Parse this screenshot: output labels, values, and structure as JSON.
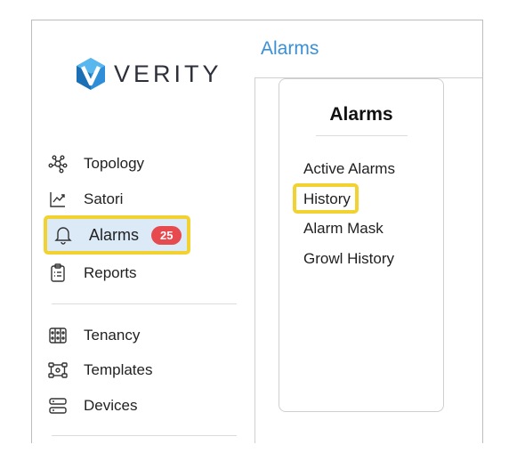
{
  "brand": {
    "name": "VERITY"
  },
  "sidebar": {
    "items": [
      {
        "label": "Topology",
        "icon": "topology-icon"
      },
      {
        "label": "Satori",
        "icon": "chart-icon"
      },
      {
        "label": "Alarms",
        "icon": "bell-icon",
        "badge": "25",
        "active": true
      },
      {
        "label": "Reports",
        "icon": "clipboard-icon"
      },
      {
        "label": "Tenancy",
        "icon": "tenancy-icon"
      },
      {
        "label": "Templates",
        "icon": "templates-icon"
      },
      {
        "label": "Devices",
        "icon": "devices-icon"
      }
    ]
  },
  "header": {
    "title": "Alarms"
  },
  "card": {
    "title": "Alarms",
    "items": [
      {
        "label": "Active Alarms"
      },
      {
        "label": "History",
        "highlighted": true
      },
      {
        "label": "Alarm Mask"
      },
      {
        "label": "Growl History"
      }
    ]
  },
  "colors": {
    "accent": "#3b8fd6",
    "highlight": "#f2d230",
    "badge": "#e64a4f",
    "active_bg": "#dbeaf6"
  }
}
